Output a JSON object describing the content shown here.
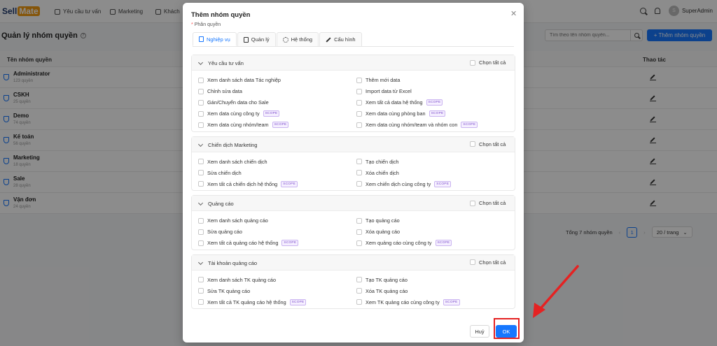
{
  "app": {
    "logo": {
      "part1": "Sell",
      "part2": "Mate"
    },
    "nav": [
      {
        "label": "Yêu cầu tư vấn"
      },
      {
        "label": "Marketing"
      },
      {
        "label": "Khách"
      }
    ],
    "user": {
      "initial": "S",
      "name": "SuperAdmin"
    },
    "page_title": "Quản lý nhóm quyền",
    "search_placeholder": "Tìm theo tên nhóm quyền...",
    "add_button": "+ Thêm nhóm quyền",
    "table": {
      "col_name": "Tên nhóm quyền",
      "col_actions": "Thao tác",
      "rows": [
        {
          "name": "Administrator",
          "count": "123 quyền"
        },
        {
          "name": "CSKH",
          "count": "25 quyền"
        },
        {
          "name": "Demo",
          "count": "74 quyền"
        },
        {
          "name": "Kế toán",
          "count": "56 quyền"
        },
        {
          "name": "Marketing",
          "count": "18 quyền"
        },
        {
          "name": "Sale",
          "count": "28 quyền"
        },
        {
          "name": "Vận đơn",
          "count": "24 quyền"
        }
      ]
    },
    "pagination": {
      "total": "Tổng 7 nhóm quyền",
      "page": "1",
      "page_size": "20 / trang"
    }
  },
  "modal": {
    "title": "Thêm nhóm quyền",
    "field_label": "Phân quyền",
    "tabs": [
      {
        "label": "Nghiệp vụ",
        "active": true
      },
      {
        "label": "Quản lý"
      },
      {
        "label": "Hệ thống"
      },
      {
        "label": "Cấu hình"
      }
    ],
    "select_all_label": "Chọn tất cả",
    "scope_badge": "SCOPE",
    "sections": [
      {
        "title": "Yêu cầu tư vấn",
        "perms": [
          {
            "label": "Xem danh sách data Tác nghiệp"
          },
          {
            "label": "Thêm mới data"
          },
          {
            "label": "Chỉnh sửa data"
          },
          {
            "label": "Import data từ Excel"
          },
          {
            "label": "Gán/Chuyển data cho Sale"
          },
          {
            "label": "Xem tất cả data hệ thống",
            "scope": "SCOPE"
          },
          {
            "label": "Xem data cùng công ty",
            "scope": "SCOPE"
          },
          {
            "label": "Xem data cùng phòng ban",
            "scope": "SCOPE"
          },
          {
            "label": "Xem data cùng nhóm/team",
            "scope": "SCOPE"
          },
          {
            "label": "Xem data cùng nhóm/team và nhóm con",
            "scope": "SCOPE"
          }
        ]
      },
      {
        "title": "Chiến dịch Marketing",
        "perms": [
          {
            "label": "Xem danh sách chiến dịch"
          },
          {
            "label": "Tạo chiến dịch"
          },
          {
            "label": "Sửa chiến dịch"
          },
          {
            "label": "Xóa chiến dịch"
          },
          {
            "label": "Xem tất cả chiến dịch hệ thống",
            "scope": "SCOPE"
          },
          {
            "label": "Xem chiến dịch cùng công ty",
            "scope": "SCOPE"
          }
        ]
      },
      {
        "title": "Quảng cáo",
        "perms": [
          {
            "label": "Xem danh sách quảng cáo"
          },
          {
            "label": "Tạo quảng cáo"
          },
          {
            "label": "Sửa quảng cáo"
          },
          {
            "label": "Xóa quảng cáo"
          },
          {
            "label": "Xem tất cả quảng cáo hệ thống",
            "scope": "SCOPE"
          },
          {
            "label": "Xem quảng cáo cùng công ty",
            "scope": "SCOPE"
          }
        ]
      },
      {
        "title": "Tài khoản quảng cáo",
        "perms": [
          {
            "label": "Xem danh sách TK quảng cáo"
          },
          {
            "label": "Tạo TK quảng cáo"
          },
          {
            "label": "Sửa TK quảng cáo"
          },
          {
            "label": "Xóa TK quảng cáo"
          },
          {
            "label": "Xem tất cả TK quảng cáo hệ thống",
            "scope": "SCOPE"
          },
          {
            "label": "Xem TK quảng cáo cùng công ty",
            "scope": "SCOPE"
          }
        ]
      }
    ],
    "footer": {
      "cancel": "Huỷ",
      "ok": "OK"
    }
  },
  "colors": {
    "primary": "#1677ff",
    "highlight": "#e52222",
    "scope": "#7c4dcc"
  }
}
